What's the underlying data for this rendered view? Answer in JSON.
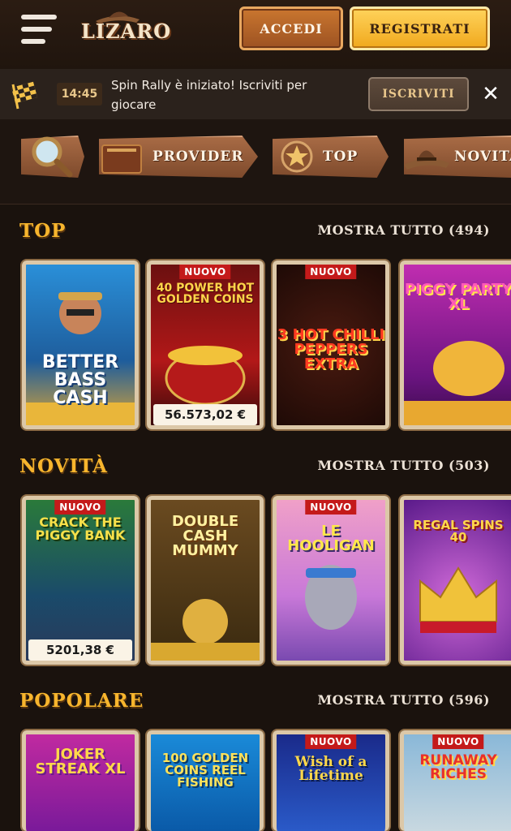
{
  "header": {
    "logo_text": "LIZARO",
    "login_label": "ACCEDI",
    "register_label": "REGISTRATI"
  },
  "notification": {
    "time": "14:45",
    "message": "Spin Rally è iniziato! Iscriviti per giocare",
    "cta_label": "ISCRIVITI",
    "close_symbol": "✕"
  },
  "categories": [
    {
      "label": "",
      "icon": "search-icon"
    },
    {
      "label": "PROVIDER",
      "icon": "book-icon"
    },
    {
      "label": "TOP",
      "icon": "sheriff-star-icon"
    },
    {
      "label": "NOVITÀ",
      "icon": "cowboy-hat-icon"
    }
  ],
  "sections": [
    {
      "title": "TOP",
      "show_all": "MOSTRA TUTTO (494)",
      "games": [
        {
          "title": "BETTER BASS CASH",
          "badge": "",
          "jackpot": ""
        },
        {
          "title": "40 POWER HOT GOLDEN COINS",
          "badge": "NUOVO",
          "jackpot": "56.573,02 €"
        },
        {
          "title": "3 HOT CHILLI PEPPERS EXTRA",
          "badge": "NUOVO",
          "jackpot": ""
        },
        {
          "title": "PIGGY PARTY XL",
          "badge": "",
          "jackpot": ""
        }
      ]
    },
    {
      "title": "NOVITÀ",
      "show_all": "MOSTRA TUTTO (503)",
      "games": [
        {
          "title": "CRACK THE PIGGY BANK",
          "badge": "NUOVO",
          "jackpot": "5201,38 €"
        },
        {
          "title": "DOUBLE CASH MUMMY",
          "badge": "",
          "jackpot": ""
        },
        {
          "title": "LE HOOLIGAN",
          "badge": "NUOVO",
          "jackpot": ""
        },
        {
          "title": "REGAL SPINS 40",
          "badge": "",
          "jackpot": ""
        }
      ]
    },
    {
      "title": "POPOLARE",
      "show_all": "MOSTRA TUTTO (596)",
      "games": [
        {
          "title": "JOKER STREAK XL",
          "badge": "",
          "jackpot": ""
        },
        {
          "title": "100 GOLDEN COINS REEL FISHING",
          "badge": "",
          "jackpot": ""
        },
        {
          "title": "Wish of a Lifetime",
          "badge": "NUOVO",
          "jackpot": ""
        },
        {
          "title": "RUNAWAY RICHES",
          "badge": "NUOVO",
          "jackpot": ""
        }
      ]
    }
  ],
  "colors": {
    "background": "#1a120d",
    "section_title": "#f7b52d",
    "register_button": "#f0a81d",
    "login_button": "#b8652a",
    "badge_new": "#c41a1a"
  }
}
